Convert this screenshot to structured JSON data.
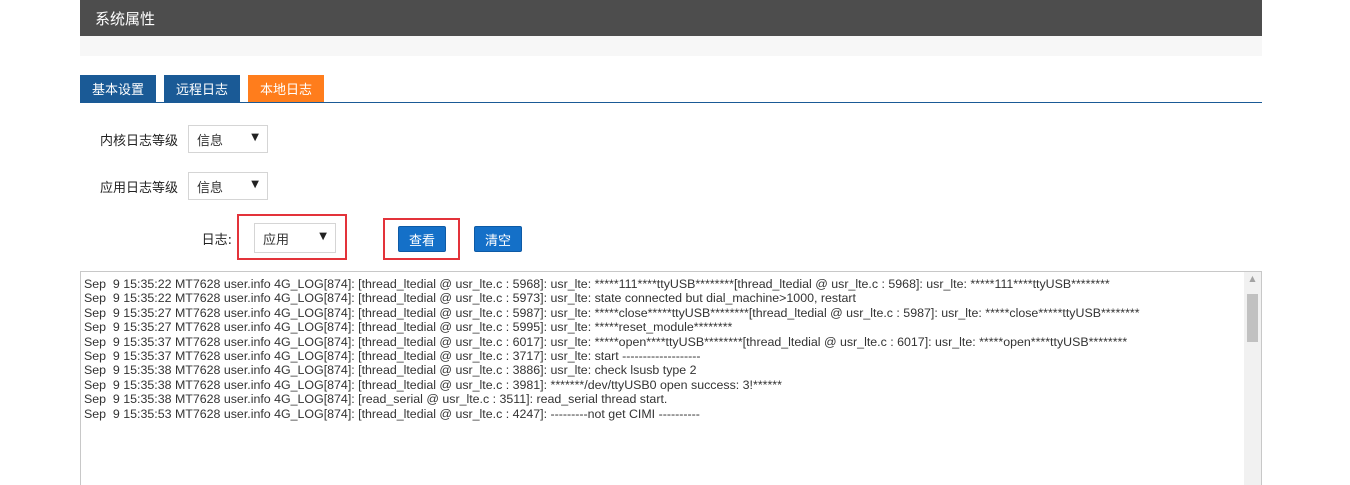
{
  "header": {
    "title": "系统属性"
  },
  "tabs": [
    {
      "label": "基本设置",
      "active": false
    },
    {
      "label": "远程日志",
      "active": false
    },
    {
      "label": "本地日志",
      "active": true
    }
  ],
  "form": {
    "kernel_log_level": {
      "label": "内核日志等级",
      "value": "信息"
    },
    "app_log_level": {
      "label": "应用日志等级",
      "value": "信息"
    },
    "log": {
      "label": "日志:",
      "value": "应用"
    },
    "view_button": "查看",
    "clear_button": "清空"
  },
  "log_text": "Sep  9 15:35:22 MT7628 user.info 4G_LOG[874]: [thread_ltedial @ usr_lte.c : 5968]: usr_lte: *****111****ttyUSB********[thread_ltedial @ usr_lte.c : 5968]: usr_lte: *****111****ttyUSB********\nSep  9 15:35:22 MT7628 user.info 4G_LOG[874]: [thread_ltedial @ usr_lte.c : 5973]: usr_lte: state connected but dial_machine>1000, restart\nSep  9 15:35:27 MT7628 user.info 4G_LOG[874]: [thread_ltedial @ usr_lte.c : 5987]: usr_lte: *****close*****ttyUSB********[thread_ltedial @ usr_lte.c : 5987]: usr_lte: *****close*****ttyUSB********\nSep  9 15:35:27 MT7628 user.info 4G_LOG[874]: [thread_ltedial @ usr_lte.c : 5995]: usr_lte: *****reset_module********\nSep  9 15:35:37 MT7628 user.info 4G_LOG[874]: [thread_ltedial @ usr_lte.c : 6017]: usr_lte: *****open****ttyUSB********[thread_ltedial @ usr_lte.c : 6017]: usr_lte: *****open****ttyUSB********\nSep  9 15:35:37 MT7628 user.info 4G_LOG[874]: [thread_ltedial @ usr_lte.c : 3717]: usr_lte: start -------------------\nSep  9 15:35:38 MT7628 user.info 4G_LOG[874]: [thread_ltedial @ usr_lte.c : 3886]: usr_lte: check lsusb type 2\nSep  9 15:35:38 MT7628 user.info 4G_LOG[874]: [thread_ltedial @ usr_lte.c : 3981]: *******/dev/ttyUSB0 open success: 3!******\nSep  9 15:35:38 MT7628 user.info 4G_LOG[874]: [read_serial @ usr_lte.c : 3511]: read_serial thread start.\nSep  9 15:35:53 MT7628 user.info 4G_LOG[874]: [thread_ltedial @ usr_lte.c : 4247]: ---------not get CIMI ----------"
}
